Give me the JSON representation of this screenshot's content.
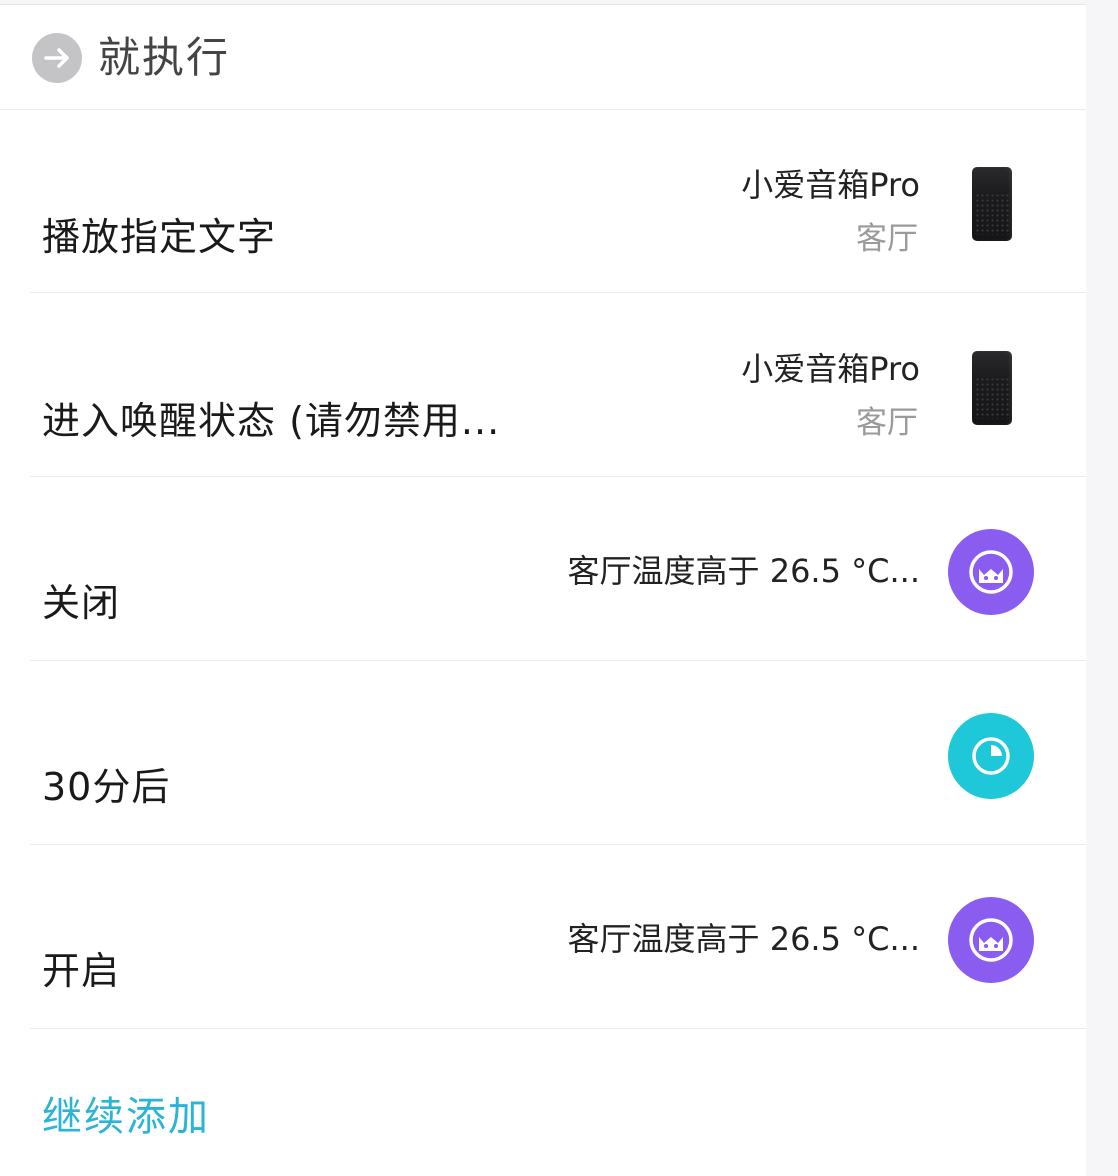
{
  "header": {
    "title": "就执行",
    "icon": "arrow-right-icon"
  },
  "actions": [
    {
      "label": "播放指定文字",
      "device": "小爱音箱Pro",
      "room": "客厅",
      "icon": "speaker-device-icon"
    },
    {
      "label": "进入唤醒状态 (请勿禁用...",
      "device": "小爱音箱Pro",
      "room": "客厅",
      "icon": "speaker-device-icon"
    },
    {
      "label": "关闭",
      "condition": "客厅温度高于 26.5 °C...",
      "icon": "cat-automation-icon",
      "icon_color": "#8a5cf0"
    },
    {
      "label": "30分后",
      "icon": "timer-icon",
      "icon_color": "#1fc8d8"
    },
    {
      "label": "开启",
      "condition": "客厅温度高于 26.5 °C...",
      "icon": "cat-automation-icon",
      "icon_color": "#8a5cf0"
    }
  ],
  "add_more": {
    "label": "继续添加",
    "color": "#2ab4d6"
  }
}
